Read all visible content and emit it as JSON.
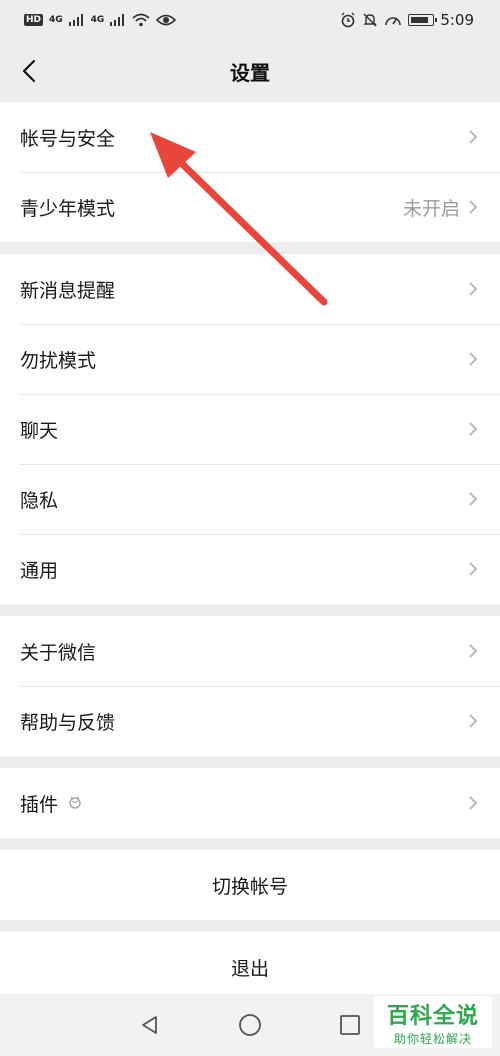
{
  "status_bar": {
    "hd": "HD",
    "signal1": "4G",
    "signal2": "4G",
    "time": "5:09"
  },
  "header": {
    "title": "设置"
  },
  "groups": [
    {
      "items": [
        {
          "label": "帐号与安全",
          "value": ""
        },
        {
          "label": "青少年模式",
          "value": "未开启"
        }
      ]
    },
    {
      "items": [
        {
          "label": "新消息提醒",
          "value": ""
        },
        {
          "label": "勿扰模式",
          "value": ""
        },
        {
          "label": "聊天",
          "value": ""
        },
        {
          "label": "隐私",
          "value": ""
        },
        {
          "label": "通用",
          "value": ""
        }
      ]
    },
    {
      "items": [
        {
          "label": "关于微信",
          "value": ""
        },
        {
          "label": "帮助与反馈",
          "value": ""
        }
      ]
    },
    {
      "items": [
        {
          "label": "插件",
          "value": ""
        }
      ]
    }
  ],
  "actions": {
    "switch_account": "切换帐号",
    "logout": "退出"
  },
  "watermark": {
    "main": "百科全说",
    "sub": "助你轻松解决"
  },
  "colors": {
    "arrow": "#e8453c",
    "watermark": "#2aa84a"
  }
}
